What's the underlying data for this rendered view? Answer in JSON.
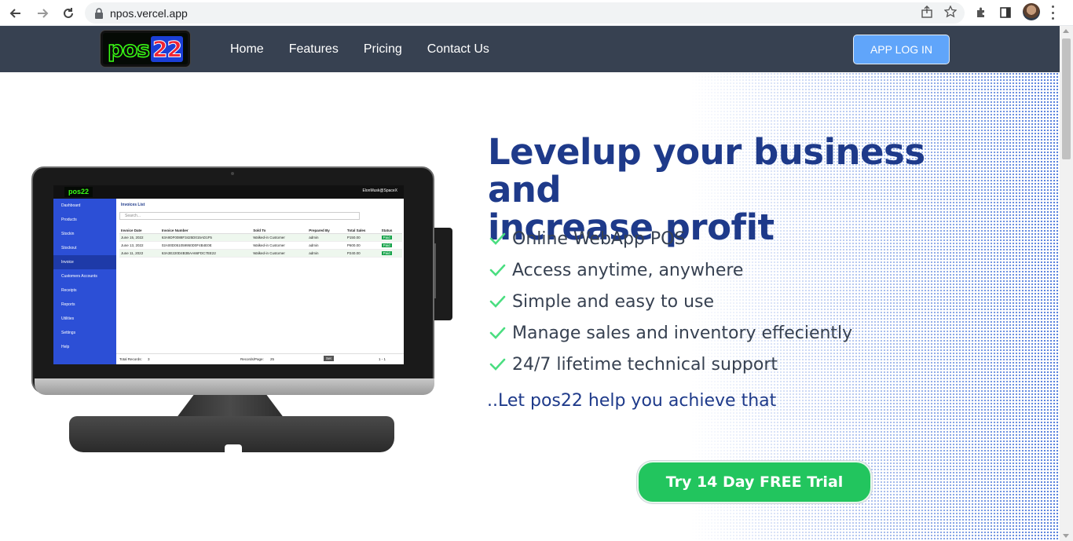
{
  "browser": {
    "url": "npos.vercel.app"
  },
  "header": {
    "logo_text_a": "pos",
    "logo_text_b": "22",
    "nav": [
      "Home",
      "Features",
      "Pricing",
      "Contact Us"
    ],
    "login_label": "APP LOG IN"
  },
  "hero": {
    "headline_line1": "Levelup your business and",
    "headline_line2": "increase profit",
    "features": [
      "Online WebApp POS",
      "Access anytime, anywhere",
      "Simple and easy to use",
      "Manage sales and inventory effeciently",
      "24/7 lifetime technical support"
    ],
    "tagline": "..Let pos22 help you achieve that",
    "cta_label": "Try 14 Day FREE Trial"
  },
  "device_screen": {
    "user": "ElonMusk@SpaceX",
    "title": "Invoices List",
    "search_placeholder": "Search...",
    "sidebar": [
      "Dashboard",
      "Products",
      "Stockin",
      "Stockout",
      "Invoice",
      "Customers Accounts",
      "Receipts",
      "Reports",
      "Utilities",
      "Settings",
      "Help"
    ],
    "columns": [
      "Invoice Date",
      "Invoice Number",
      "Sold To",
      "Prepared By",
      "Total Sales",
      "Status"
    ],
    "rows": [
      [
        "June 15, 2022",
        "63A9DF0088F3425D015AD1F5",
        "Walked-in Customer",
        "admin",
        "P150.00",
        "Paid"
      ],
      [
        "June 13, 2022",
        "02A00D051059950D0F4B4E0E",
        "Walked-in Customer",
        "admin",
        "P600.00",
        "Paid"
      ],
      [
        "June 11, 2022",
        "63A3E220D4B3BAA66FDC7EE22",
        "Walked-in Customer",
        "admin",
        "P240.00",
        "Paid"
      ]
    ],
    "footer_total": "Total Records:",
    "footer_total_value": "3",
    "footer_per_page": "Records/Page:",
    "footer_per_page_value": "25",
    "footer_set": "Set",
    "footer_pages": "1 - 1"
  },
  "colors": {
    "header_bg": "#374151",
    "accent_blue": "#60a5fa",
    "headline": "#1e3a8a",
    "cta_green": "#22c55e",
    "check_green": "#4ade80"
  }
}
